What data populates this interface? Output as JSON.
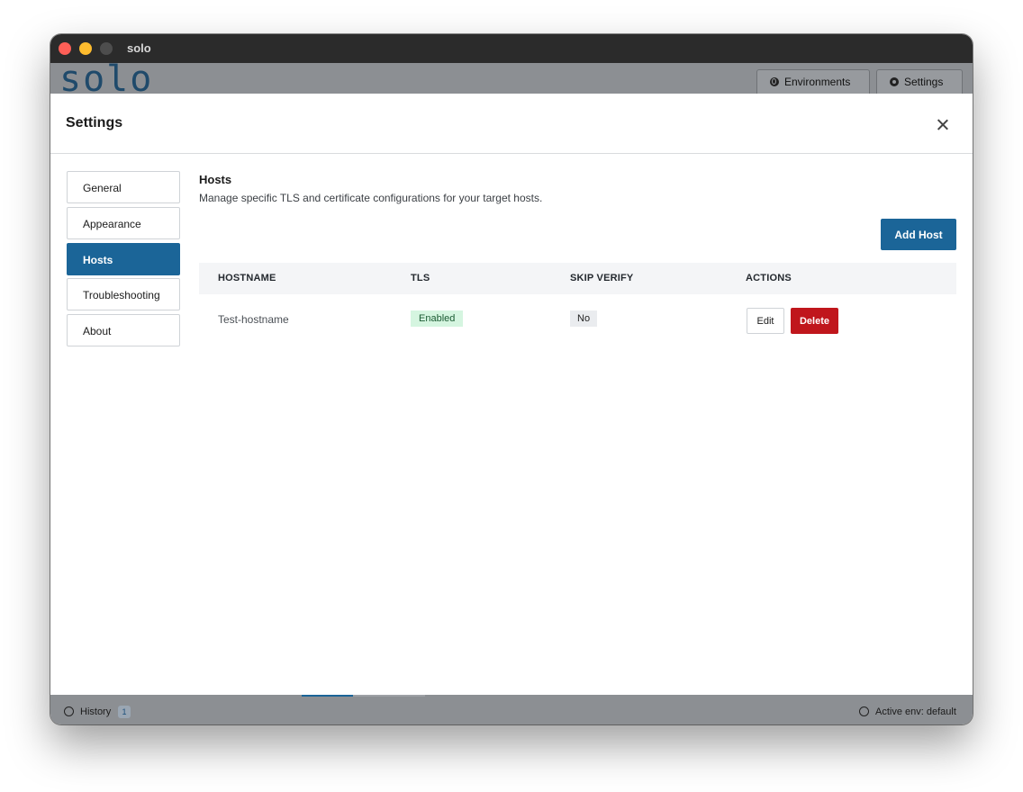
{
  "window": {
    "title": "solo"
  },
  "app_header": {
    "logo": "solo",
    "buttons": [
      {
        "label": "Environments",
        "icon": "globe-icon"
      },
      {
        "label": "Settings",
        "icon": "gear-icon"
      }
    ]
  },
  "modal": {
    "title": "Settings",
    "close_icon": "close-icon",
    "nav": [
      {
        "label": "General",
        "active": false
      },
      {
        "label": "Appearance",
        "active": false
      },
      {
        "label": "Hosts",
        "active": true
      },
      {
        "label": "Troubleshooting",
        "active": false
      },
      {
        "label": "About",
        "active": false
      }
    ],
    "section": {
      "title": "Hosts",
      "description": "Manage specific TLS and certificate configurations for your target hosts.",
      "add_button": "Add Host"
    },
    "table": {
      "headers": [
        "HOSTNAME",
        "TLS",
        "SKIP VERIFY",
        "ACTIONS"
      ],
      "rows": [
        {
          "hostname": "Test-hostname",
          "tls": "Enabled",
          "skip_verify": "No",
          "edit": "Edit",
          "delete": "Delete"
        }
      ]
    }
  },
  "statusbar": {
    "history_label": "History",
    "history_count": "1",
    "active_env": "Active env: default"
  },
  "colors": {
    "accent": "#1b6598",
    "danger": "#c0161c",
    "tls_badge_bg": "#d5f5e0"
  }
}
